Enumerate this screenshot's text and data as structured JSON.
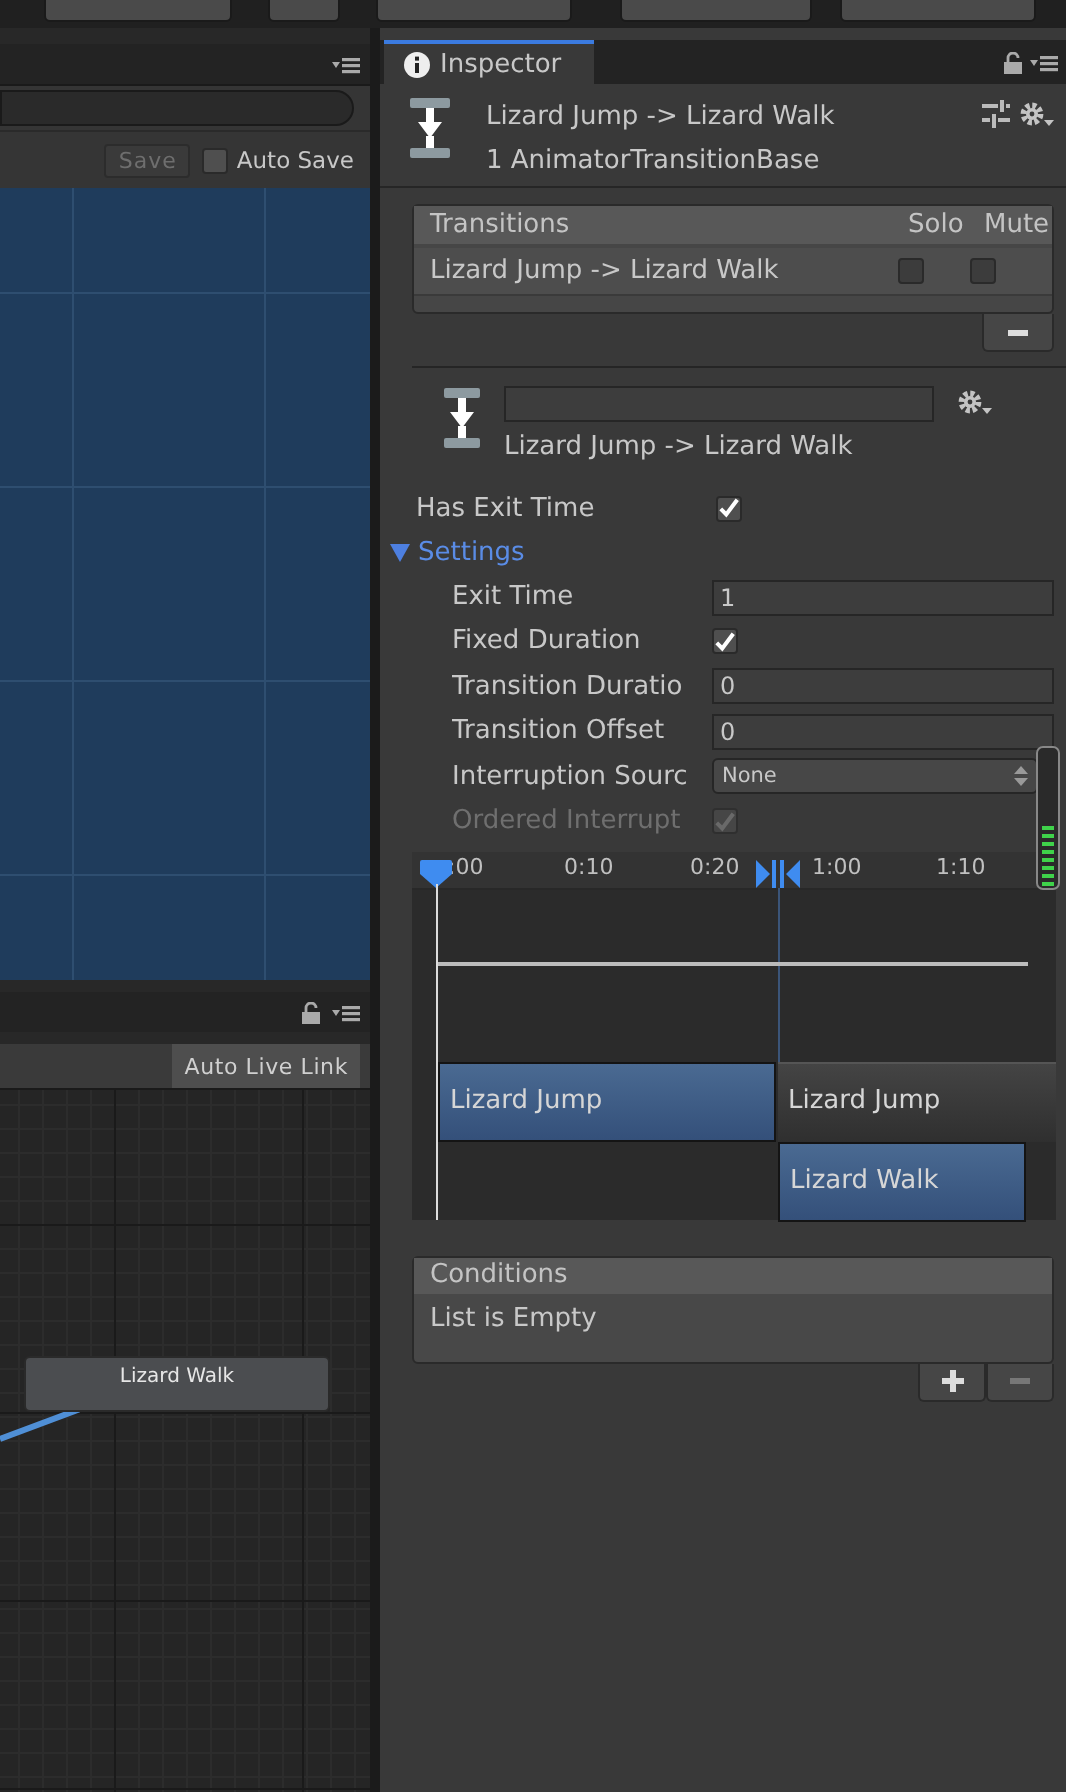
{
  "animator": {
    "save_button": "Save",
    "auto_save": {
      "label": "Auto Save",
      "checked": false
    },
    "live_link_button": "Auto Live Link",
    "nodes": [
      {
        "label": "Lizard Walk"
      }
    ]
  },
  "inspector": {
    "tab": "Inspector",
    "title": "Lizard Jump -> Lizard Walk",
    "subtitle": "1 AnimatorTransitionBase",
    "transitions": {
      "columns": [
        "Transitions",
        "Solo",
        "Mute"
      ],
      "rows": [
        {
          "name": "Lizard Jump -> Lizard Walk",
          "solo": false,
          "mute": false
        }
      ]
    },
    "transition": {
      "label": "Lizard Jump -> Lizard Walk"
    },
    "has_exit_time": {
      "label": "Has Exit Time",
      "checked": true
    },
    "settings": {
      "label": "Settings",
      "expanded": true,
      "rows": [
        {
          "kind": "field",
          "label": "Exit Time",
          "value": "1",
          "disabled": false
        },
        {
          "kind": "checkbox",
          "label": "Fixed Duration",
          "checked": true,
          "disabled": false
        },
        {
          "kind": "field",
          "label": "Transition Duratio",
          "value": "0",
          "disabled": false
        },
        {
          "kind": "field",
          "label": "Transition Offset",
          "value": "0",
          "disabled": false
        },
        {
          "kind": "dropdown",
          "label": "Interruption Sourc",
          "value": "None",
          "disabled": false
        },
        {
          "kind": "checkbox",
          "label": "Ordered Interrupt",
          "checked": true,
          "disabled": true
        }
      ]
    },
    "timeline": {
      "ticks": [
        ":00",
        "0:10",
        "0:20",
        "1:00",
        "1:10"
      ],
      "clips": [
        {
          "kind": "source",
          "label": "Lizard Jump"
        },
        {
          "kind": "tail",
          "label": "Lizard Jump"
        },
        {
          "kind": "destination",
          "label": "Lizard Walk"
        }
      ]
    },
    "conditions": {
      "title": "Conditions",
      "empty_text": "List is Empty"
    }
  }
}
